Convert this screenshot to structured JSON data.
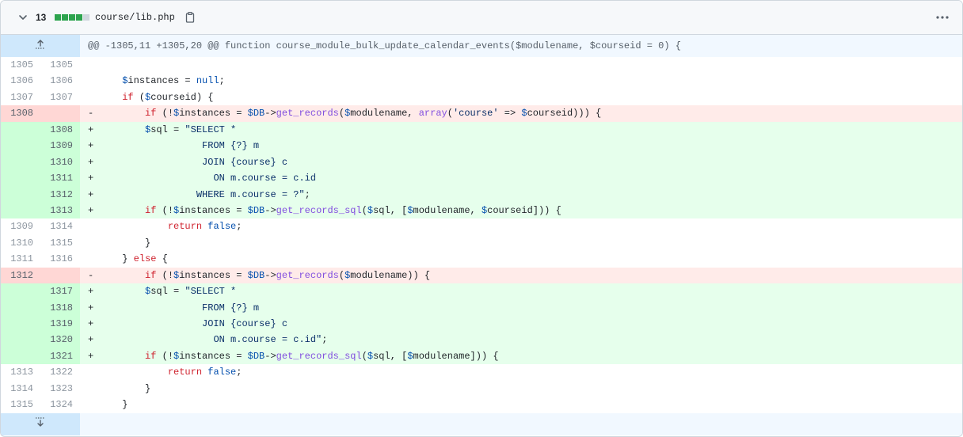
{
  "file_header": {
    "changes_count": "13",
    "diffstat": [
      "added",
      "added",
      "added",
      "added",
      "neutral"
    ],
    "colors": {
      "added": "#2da44e",
      "removed": "#cf222e",
      "neutral": "#d0d7de"
    },
    "filename": "course/lib.php",
    "icons": {
      "collapse": "chevron-down-icon",
      "copy": "copy-icon",
      "more": "kebab-horizontal-icon"
    }
  },
  "hunk_header": "@@ -1305,11 +1305,20 @@ function course_module_bulk_update_calendar_events($modulename, $courseid = 0) {",
  "lines": [
    {
      "type": "ctx",
      "old": "1305",
      "new": "1305",
      "sign": " ",
      "code": ""
    },
    {
      "type": "ctx",
      "old": "1306",
      "new": "1306",
      "sign": " ",
      "code": "    $instances = null;"
    },
    {
      "type": "ctx",
      "old": "1307",
      "new": "1307",
      "sign": " ",
      "code": "    if ($courseid) {"
    },
    {
      "type": "del",
      "old": "1308",
      "new": "",
      "sign": "-",
      "code": "        if (!$instances = $DB->get_records($modulename, array('course' => $courseid))) {"
    },
    {
      "type": "add",
      "old": "",
      "new": "1308",
      "sign": "+",
      "code": "        $sql = \"SELECT *"
    },
    {
      "type": "add",
      "old": "",
      "new": "1309",
      "sign": "+",
      "code": "                  FROM {?} m"
    },
    {
      "type": "add",
      "old": "",
      "new": "1310",
      "sign": "+",
      "code": "                  JOIN {course} c"
    },
    {
      "type": "add",
      "old": "",
      "new": "1311",
      "sign": "+",
      "code": "                    ON m.course = c.id"
    },
    {
      "type": "add",
      "old": "",
      "new": "1312",
      "sign": "+",
      "code": "                 WHERE m.course = ?\";"
    },
    {
      "type": "add",
      "old": "",
      "new": "1313",
      "sign": "+",
      "code": "        if (!$instances = $DB->get_records_sql($sql, [$modulename, $courseid])) {"
    },
    {
      "type": "ctx",
      "old": "1309",
      "new": "1314",
      "sign": " ",
      "code": "            return false;"
    },
    {
      "type": "ctx",
      "old": "1310",
      "new": "1315",
      "sign": " ",
      "code": "        }"
    },
    {
      "type": "ctx",
      "old": "1311",
      "new": "1316",
      "sign": " ",
      "code": "    } else {"
    },
    {
      "type": "del",
      "old": "1312",
      "new": "",
      "sign": "-",
      "code": "        if (!$instances = $DB->get_records($modulename)) {"
    },
    {
      "type": "add",
      "old": "",
      "new": "1317",
      "sign": "+",
      "code": "        $sql = \"SELECT *"
    },
    {
      "type": "add",
      "old": "",
      "new": "1318",
      "sign": "+",
      "code": "                  FROM {?} m"
    },
    {
      "type": "add",
      "old": "",
      "new": "1319",
      "sign": "+",
      "code": "                  JOIN {course} c"
    },
    {
      "type": "add",
      "old": "",
      "new": "1320",
      "sign": "+",
      "code": "                    ON m.course = c.id\";"
    },
    {
      "type": "add",
      "old": "",
      "new": "1321",
      "sign": "+",
      "code": "        if (!$instances = $DB->get_records_sql($sql, [$modulename])) {"
    },
    {
      "type": "ctx",
      "old": "1313",
      "new": "1322",
      "sign": " ",
      "code": "            return false;"
    },
    {
      "type": "ctx",
      "old": "1314",
      "new": "1323",
      "sign": " ",
      "code": "        }"
    },
    {
      "type": "ctx",
      "old": "1315",
      "new": "1324",
      "sign": " ",
      "code": "    }"
    }
  ],
  "expanders": {
    "up": "expand-up-icon",
    "down": "expand-down-icon"
  }
}
